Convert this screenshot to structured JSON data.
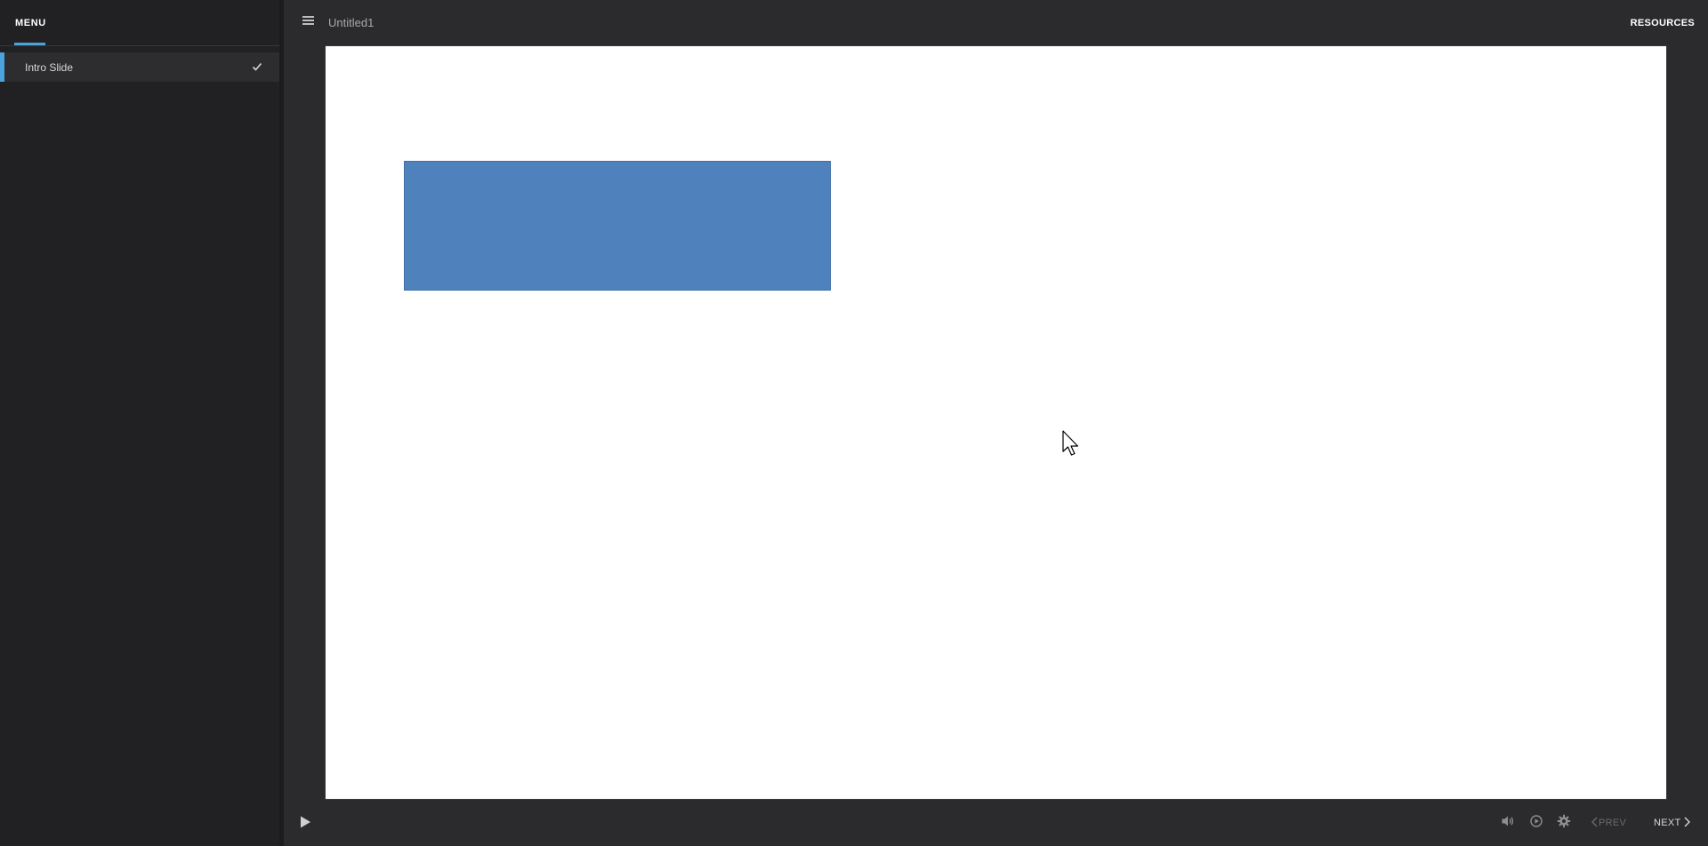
{
  "sidebar": {
    "tab_label": "MENU",
    "items": [
      {
        "label": "Intro Slide",
        "completed": true
      }
    ]
  },
  "header": {
    "title": "Untitled1",
    "resources_label": "RESOURCES"
  },
  "slide": {
    "shape_color": "#4f81bd"
  },
  "controls": {
    "prev_label": "PREV",
    "next_label": "NEXT"
  },
  "colors": {
    "accent": "#4aa3df",
    "background": "#2b2b2e",
    "sidebar": "#212123"
  },
  "icons": {
    "menu": "hamburger-icon",
    "play": "play-icon",
    "volume": "volume-icon",
    "captions": "playback-speed-icon",
    "settings": "gear-icon",
    "check": "check-icon",
    "prev": "chevron-left-icon",
    "next": "chevron-right-icon"
  }
}
